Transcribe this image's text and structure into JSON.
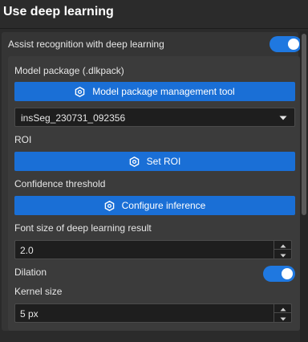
{
  "header": {
    "title": "Use deep learning"
  },
  "assist": {
    "label": "Assist recognition with deep learning",
    "enabled": true
  },
  "model_package": {
    "label": "Model package (.dlkpack)",
    "tool_button_label": "Model package management tool",
    "selected_model": "insSeg_230731_092356"
  },
  "roi": {
    "label": "ROI",
    "button_label": "Set ROI"
  },
  "confidence": {
    "label": "Confidence threshold",
    "button_label": "Configure inference"
  },
  "font_size": {
    "label": "Font size of deep learning result",
    "value": "2.0"
  },
  "dilation": {
    "label": "Dilation",
    "enabled": true
  },
  "kernel": {
    "label": "Kernel size",
    "value": "5 px"
  },
  "icons": {
    "button_icon": "hexagon-gear-icon",
    "dropdown_icon": "triangle-down-icon",
    "spin_up_icon": "chevron-up-icon",
    "spin_down_icon": "chevron-down-icon"
  },
  "colors": {
    "accent": "#1a6fd6",
    "toggle_on": "#1f78e0",
    "background": "#2b2b2b",
    "panel": "#353535",
    "inner_panel": "#3b3b3b"
  }
}
